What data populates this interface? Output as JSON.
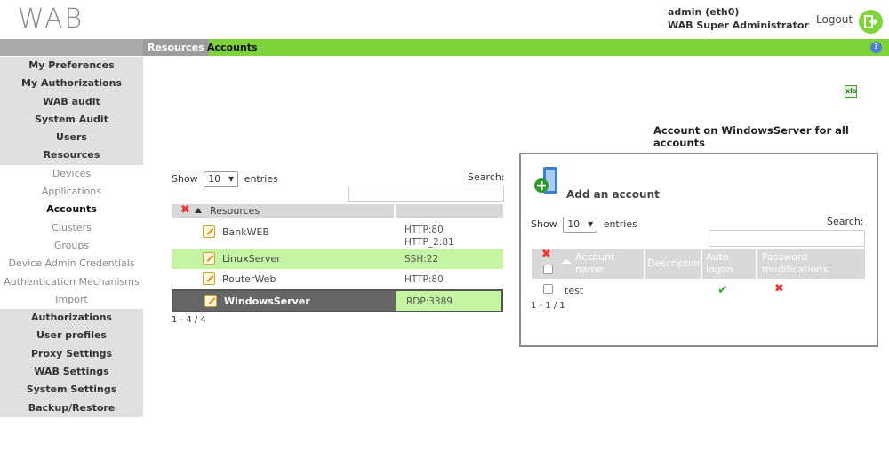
{
  "header": {
    "logo": "WAB",
    "user_line1": "admin (eth0)",
    "user_line2": "WAB Super Administrator",
    "logout_label": "Logout"
  },
  "breadcrumb": {
    "parent": "Resources",
    "current": "Accounts",
    "help": "?"
  },
  "sidebar": {
    "items": [
      {
        "label": "My Preferences"
      },
      {
        "label": "My Authorizations"
      },
      {
        "label": "WAB audit"
      },
      {
        "label": "System Audit"
      },
      {
        "label": "Users"
      },
      {
        "label": "Resources"
      },
      {
        "label": "Devices"
      },
      {
        "label": "Applications"
      },
      {
        "label": "Accounts"
      },
      {
        "label": "Clusters"
      },
      {
        "label": "Groups"
      },
      {
        "label": "Device Admin Credentials"
      },
      {
        "label": "Authentication Mechanisms"
      },
      {
        "label": "Import"
      },
      {
        "label": "Authorizations"
      },
      {
        "label": "User profiles"
      },
      {
        "label": "Proxy Settings"
      },
      {
        "label": "WAB Settings"
      },
      {
        "label": "System Settings"
      },
      {
        "label": "Backup/Restore"
      }
    ]
  },
  "main": {
    "heading": "Account on WindowsServer for all accounts",
    "export_icon": "xls",
    "resources_table": {
      "show_label": "Show",
      "entries_value": "10",
      "entries_label": "entries",
      "search_label": "Search:",
      "search_value": "",
      "column_resources": "Resources",
      "rows": [
        {
          "name": "BankWEB",
          "protocols": "HTTP:80",
          "protocols2": "HTTP_2:81"
        },
        {
          "name": "LinuxServer",
          "protocols": "SSH:22",
          "protocols2": ""
        },
        {
          "name": "RouterWeb",
          "protocols": "HTTP:80",
          "protocols2": ""
        },
        {
          "name": "WindowsServer",
          "protocols": "RDP:3389",
          "protocols2": ""
        }
      ],
      "count": "1 - 4 / 4"
    },
    "accounts_panel": {
      "add_label": "Add an account",
      "show_label": "Show",
      "entries_value": "10",
      "entries_label": "entries",
      "search_label": "Search:",
      "search_value": "",
      "columns": {
        "account_name_1": "Account",
        "account_name_2": "name",
        "description": "Description",
        "auto_logon_1": "Auto",
        "auto_logon_2": "logon",
        "password_1": "Password",
        "password_2": "modifications"
      },
      "rows": [
        {
          "name": "test",
          "description": "",
          "auto_logon": "yes",
          "password_modifications": "no"
        }
      ],
      "count": "1 - 1 / 1"
    }
  },
  "colors": {
    "accent_green": "#7ed33a",
    "row_highlight": "#c5f5a2",
    "sidebar_bg": "#e0e0e0"
  }
}
